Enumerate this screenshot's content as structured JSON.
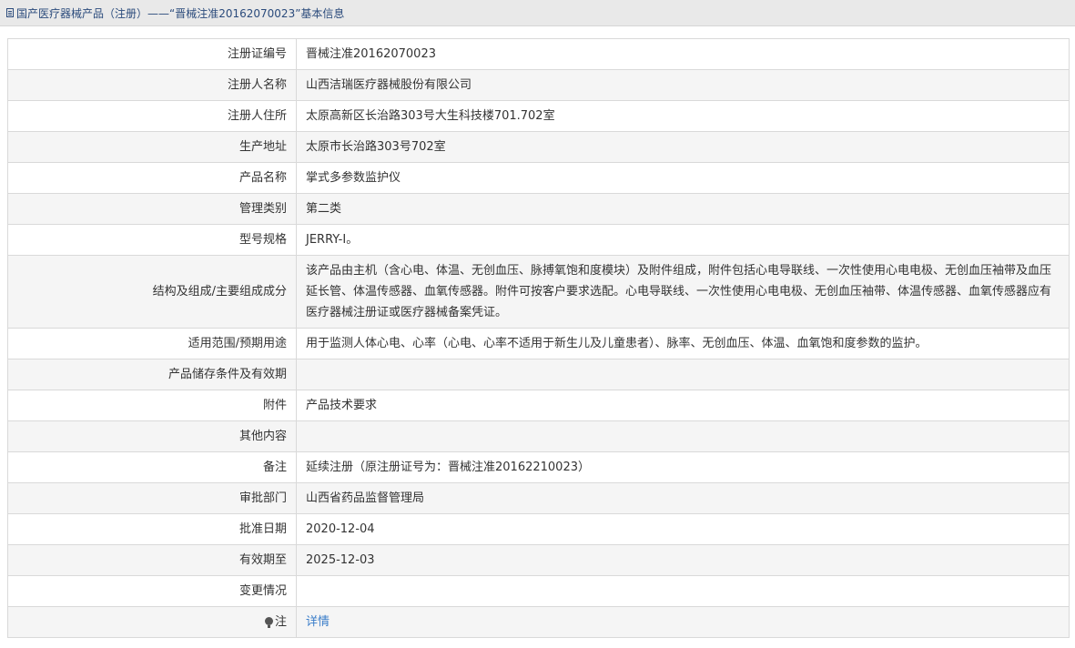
{
  "header": {
    "title": "国产医疗器械产品（注册）——“晋械注准20162070023”基本信息"
  },
  "rows": [
    {
      "label": "注册证编号",
      "value": "晋械注准20162070023"
    },
    {
      "label": "注册人名称",
      "value": "山西洁瑞医疗器械股份有限公司"
    },
    {
      "label": "注册人住所",
      "value": "太原高新区长治路303号大生科技楼701.702室"
    },
    {
      "label": "生产地址",
      "value": "太原市长治路303号702室"
    },
    {
      "label": "产品名称",
      "value": "掌式多参数监护仪"
    },
    {
      "label": "管理类别",
      "value": "第二类"
    },
    {
      "label": "型号规格",
      "value": "JERRY-Ⅰ。"
    },
    {
      "label": "结构及组成/主要组成成分",
      "value": "该产品由主机（含心电、体温、无创血压、脉搏氧饱和度模块）及附件组成，附件包括心电导联线、一次性使用心电电极、无创血压袖带及血压延长管、体温传感器、血氧传感器。附件可按客户要求选配。心电导联线、一次性使用心电电极、无创血压袖带、体温传感器、血氧传感器应有医疗器械注册证或医疗器械备案凭证。"
    },
    {
      "label": "适用范围/预期用途",
      "value": "用于监测人体心电、心率（心电、心率不适用于新生儿及儿童患者）、脉率、无创血压、体温、血氧饱和度参数的监护。"
    },
    {
      "label": "产品储存条件及有效期",
      "value": ""
    },
    {
      "label": "附件",
      "value": "产品技术要求"
    },
    {
      "label": "其他内容",
      "value": ""
    },
    {
      "label": "备注",
      "value": "延续注册（原注册证号为：晋械注准20162210023）"
    },
    {
      "label": "审批部门",
      "value": "山西省药品监督管理局"
    },
    {
      "label": "批准日期",
      "value": "2020-12-04"
    },
    {
      "label": "有效期至",
      "value": "2025-12-03"
    },
    {
      "label": "变更情况",
      "value": ""
    }
  ],
  "note": {
    "label": "注",
    "link_text": "详情",
    "icon": "bulb-icon"
  },
  "colors": {
    "title_bar_bg": "#e9e9e9",
    "title_text": "#2b4b7c",
    "alt_row_bg": "#f5f5f5",
    "border": "#d9d9d9",
    "link": "#3a7dc9"
  }
}
